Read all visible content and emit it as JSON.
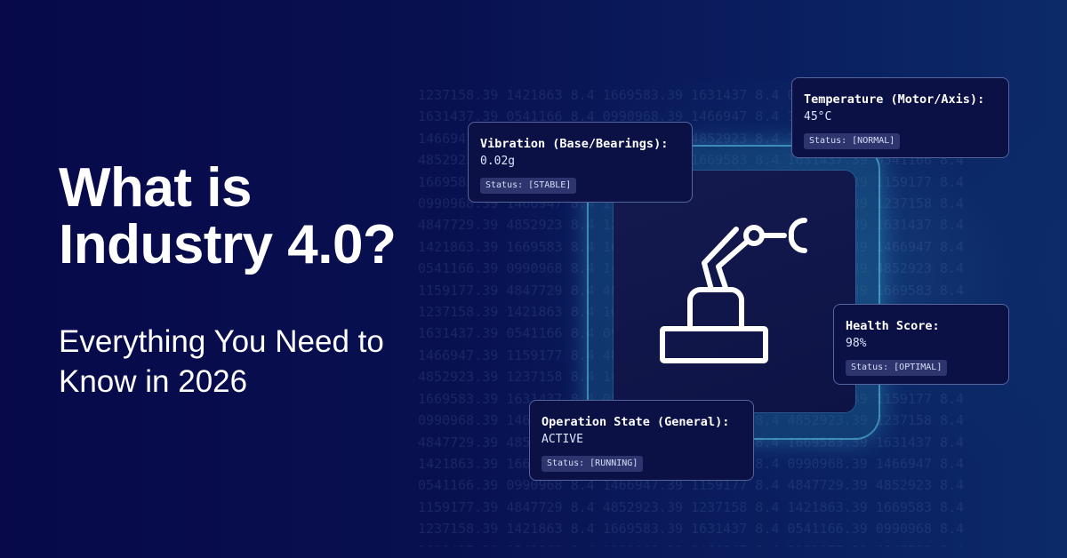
{
  "headline": {
    "line1": "What is",
    "line2": "Industry 4.0?"
  },
  "subheadline": {
    "line1": "Everything You Need to",
    "line2": "Know in 2026"
  },
  "cards": {
    "vibration": {
      "label": "Vibration (Base/Bearings):",
      "value": "0.02g",
      "status": "Status: [STABLE]"
    },
    "temperature": {
      "label": "Temperature (Motor/Axis):",
      "value": "45°C",
      "status": "Status: [NORMAL]"
    },
    "health": {
      "label": "Health Score:",
      "value": "98%",
      "status": "Status: [OPTIMAL]"
    },
    "operation": {
      "label": "Operation State (General):",
      "value": "ACTIVE",
      "status": "Status: [RUNNING]"
    }
  },
  "icons": {
    "center": "robotic-arm-icon"
  },
  "colors": {
    "background": "#07094a",
    "card_background": "#0b1045",
    "accent_glow": "#5ac8e6",
    "text": "#ffffff"
  }
}
